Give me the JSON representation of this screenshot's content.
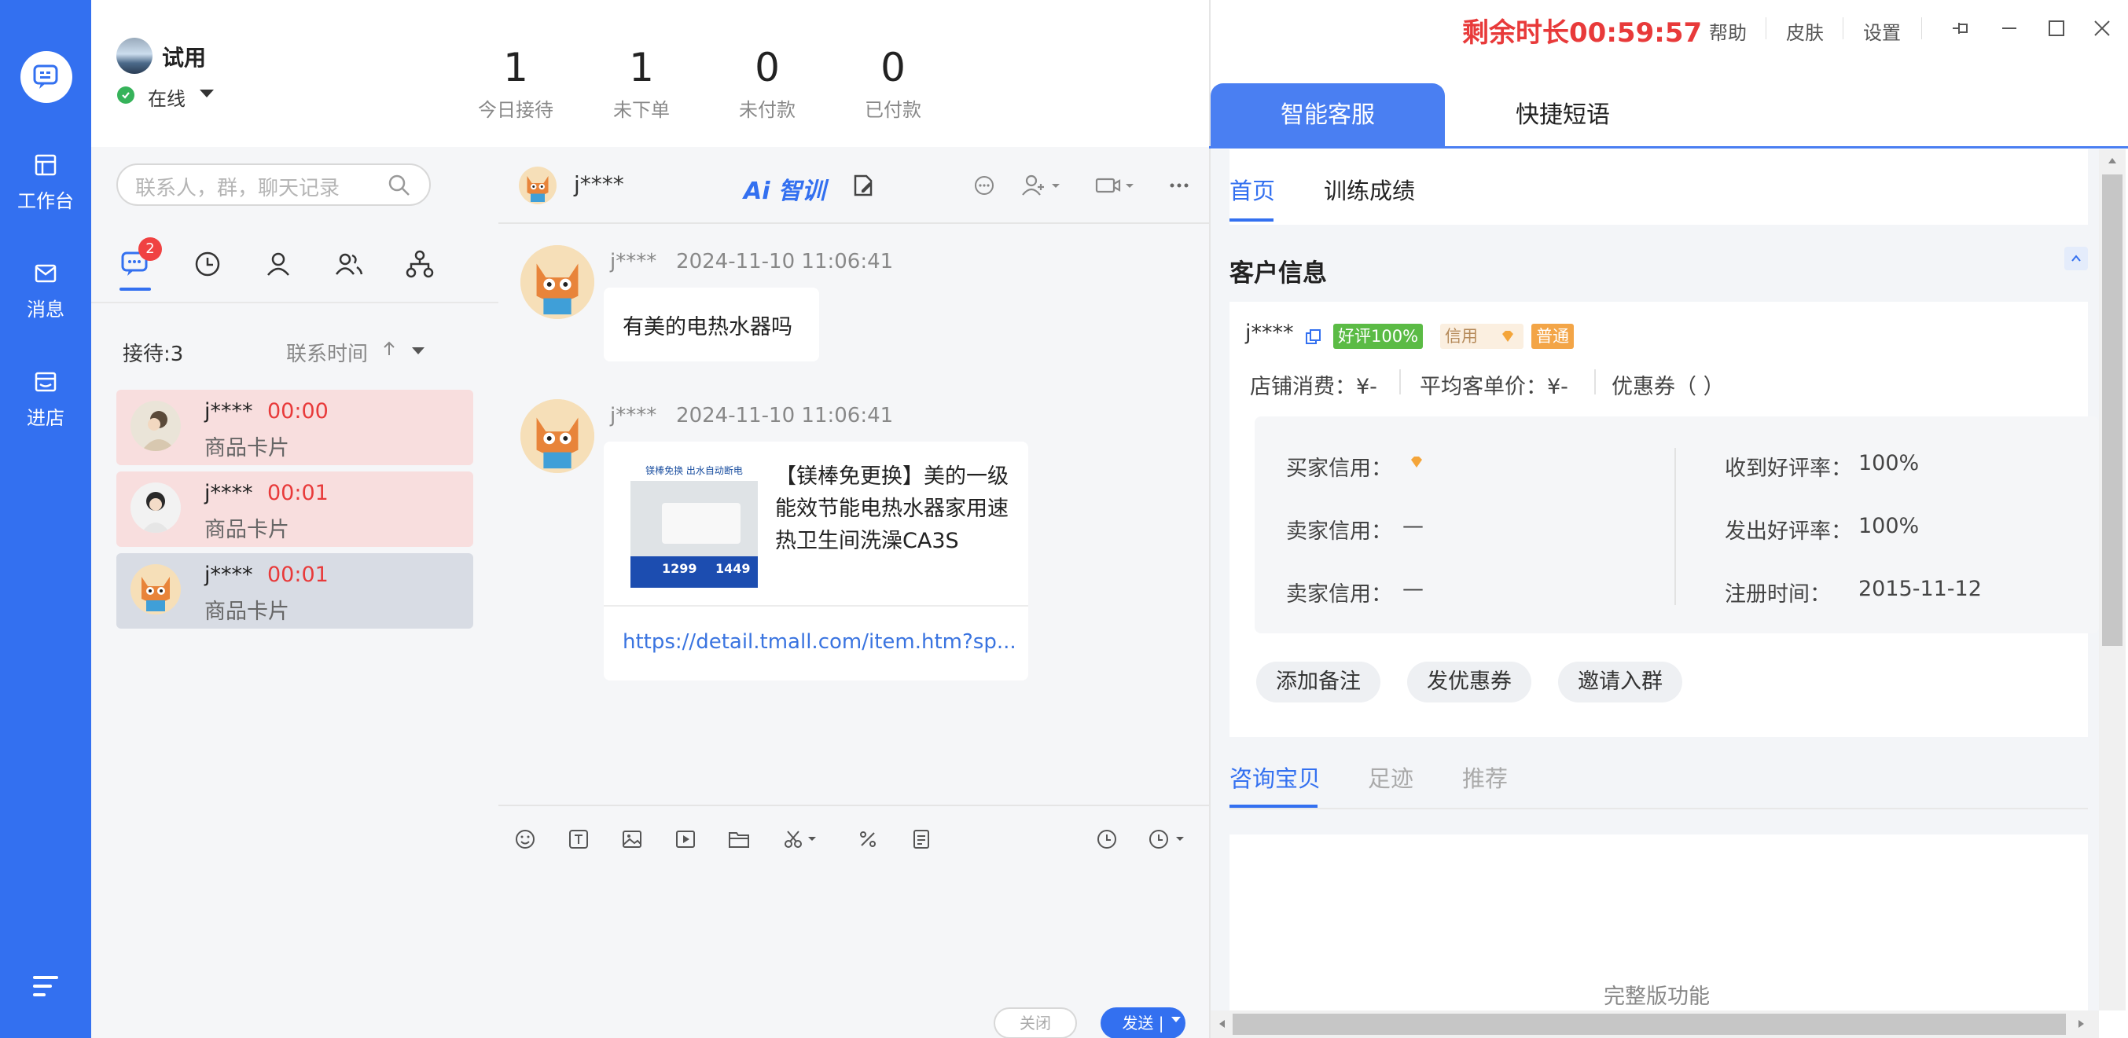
{
  "nav": {
    "items": [
      {
        "label": "工作台",
        "icon": "workbench-icon"
      },
      {
        "label": "消息",
        "icon": "mail-icon"
      },
      {
        "label": "进店",
        "icon": "store-icon"
      }
    ]
  },
  "header": {
    "user_name": "试用",
    "status": "在线",
    "stats": [
      {
        "value": "1",
        "label": "今日接待"
      },
      {
        "value": "1",
        "label": "未下单"
      },
      {
        "value": "0",
        "label": "未付款"
      },
      {
        "value": "0",
        "label": "已付款"
      }
    ],
    "timer": "剩余时长00:59:57",
    "links": [
      "帮助",
      "皮肤",
      "设置"
    ]
  },
  "conv_list": {
    "search_placeholder": "联系人，群，聊天记录",
    "unread_badge": "2",
    "reception": "接待:3",
    "sort_label": "联系时间",
    "items": [
      {
        "name": "j****",
        "time": "00:00",
        "sub": "商品卡片",
        "style": "red"
      },
      {
        "name": "j****",
        "time": "00:01",
        "sub": "商品卡片",
        "style": "red"
      },
      {
        "name": "j****",
        "time": "00:01",
        "sub": "商品卡片",
        "style": "selected"
      }
    ]
  },
  "chat": {
    "contact_name": "j****",
    "ai_label": "Ai 智训",
    "messages": [
      {
        "sender": "j****",
        "time": "2024-11-10 11:06:41",
        "text": "有美的电热水器吗"
      },
      {
        "sender": "j****",
        "time": "2024-11-10 11:06:41",
        "product_title": "【镁棒免更换】美的一级能效节能电热水器家用速热卫生间洗澡CA3S",
        "product_link": "https://detail.tmall.com/item.htm?sp...",
        "img_banner": "镁棒免换 出水自动断电",
        "img_prices": [
          "1299",
          "1449"
        ]
      }
    ],
    "close_label": "关闭",
    "send_label": "发送 |"
  },
  "right_panel": {
    "tabs": [
      "智能客服",
      "快捷短语"
    ],
    "subtabs": [
      "首页",
      "训练成绩"
    ],
    "customer_section_title": "客户信息",
    "customer_name": "j****",
    "tags": {
      "good_rate": "好评100%",
      "credit": "信用",
      "level": "普通"
    },
    "summary": {
      "store_spend": "店铺消费：¥-",
      "avg_price": "平均客单价：¥-",
      "coupon": "优惠券（ ）"
    },
    "details_left": [
      {
        "label": "买家信用：",
        "value": ""
      },
      {
        "label": "卖家信用：",
        "value": "—"
      },
      {
        "label": "卖家信用：",
        "value": "—"
      }
    ],
    "details_right": [
      {
        "label": "收到好评率：",
        "value": "100%"
      },
      {
        "label": "发出好评率：",
        "value": "100%"
      },
      {
        "label": "注册时间：",
        "value": "2015-11-12"
      }
    ],
    "actions": [
      "添加备注",
      "发优惠券",
      "邀请入群"
    ],
    "consult_tabs": [
      "咨询宝贝",
      "足迹",
      "推荐"
    ],
    "full_version": "完整版功能"
  },
  "colors": {
    "accent": "#3370f0",
    "timer_red": "#e83a3a",
    "green_tag": "#4caf50",
    "orange_tag": "#f0a040"
  }
}
